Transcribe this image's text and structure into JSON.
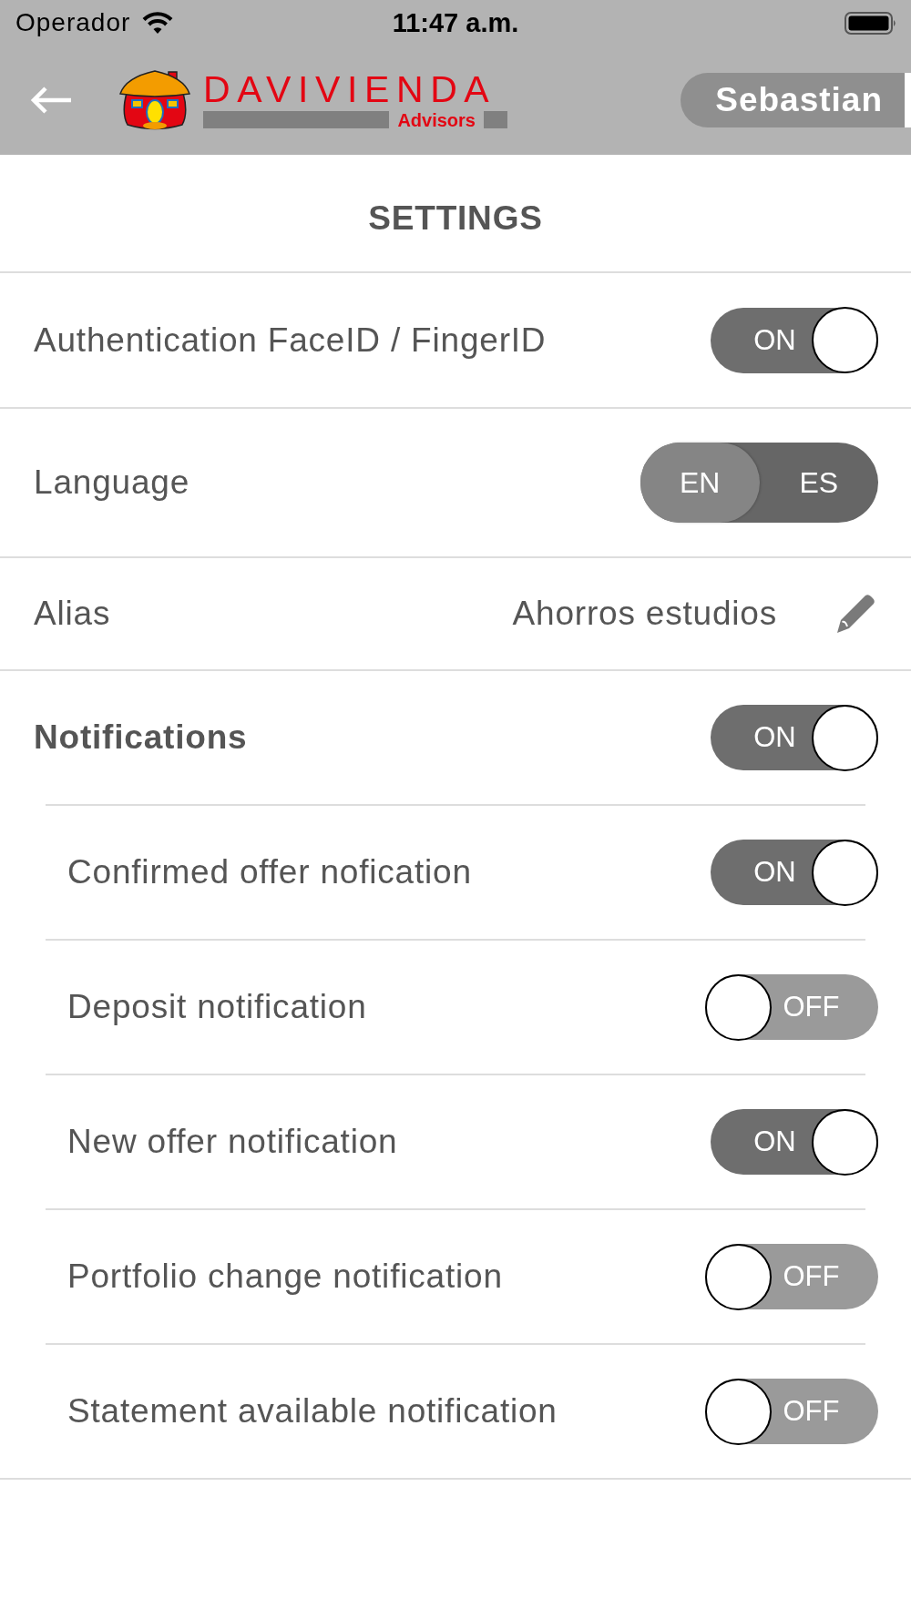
{
  "status_bar": {
    "carrier": "Operador",
    "time": "11:47 a.m."
  },
  "header": {
    "brand": "DAVIVIENDA",
    "brand_subtitle": "Advisors",
    "user_name": "Sebastian"
  },
  "title": "SETTINGS",
  "settings": [
    {
      "kind": "toggle",
      "label": "Authentication FaceID / FingerID",
      "on": true,
      "switch_text": "ON"
    },
    {
      "kind": "segmented",
      "label": "Language",
      "options": [
        {
          "label": "EN",
          "selected": true
        },
        {
          "label": "ES",
          "selected": false
        }
      ]
    },
    {
      "kind": "editable",
      "label": "Alias",
      "value": "Ahorros estudios"
    },
    {
      "kind": "group",
      "label": "Notifications",
      "on": true,
      "switch_text": "ON",
      "children": [
        {
          "label": "Confirmed offer nofication",
          "on": true,
          "switch_text": "ON"
        },
        {
          "label": "Deposit notification",
          "on": false,
          "switch_text": "OFF"
        },
        {
          "label": "New offer notification",
          "on": true,
          "switch_text": "ON"
        },
        {
          "label": "Portfolio change notification",
          "on": false,
          "switch_text": "OFF"
        },
        {
          "label": "Statement available notification",
          "on": false,
          "switch_text": "OFF"
        }
      ]
    }
  ]
}
